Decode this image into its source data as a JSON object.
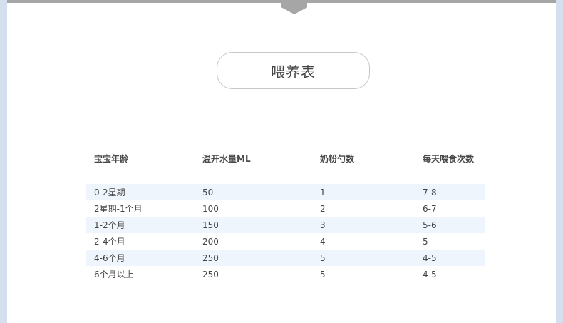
{
  "title": "喂养表",
  "table": {
    "headers": [
      "宝宝年龄",
      "温开水量ML",
      "奶粉勺数",
      "每天喂食次数"
    ],
    "rows": [
      [
        "0-2星期",
        "50",
        "1",
        "7-8"
      ],
      [
        "2星期-1个月",
        "100",
        "2",
        "6-7"
      ],
      [
        "1-2个月",
        "150",
        "3",
        "5-6"
      ],
      [
        "2-4个月",
        "200",
        "4",
        "5"
      ],
      [
        "4-6个月",
        "250",
        "5",
        "4-5"
      ],
      [
        "6个月以上",
        "250",
        "5",
        "4-5"
      ]
    ]
  },
  "colors": {
    "background": "#d5e0ee",
    "page": "#ffffff",
    "top_bar": "#a6a6a6",
    "row_shade": "#eef5fc",
    "text": "#444444"
  }
}
